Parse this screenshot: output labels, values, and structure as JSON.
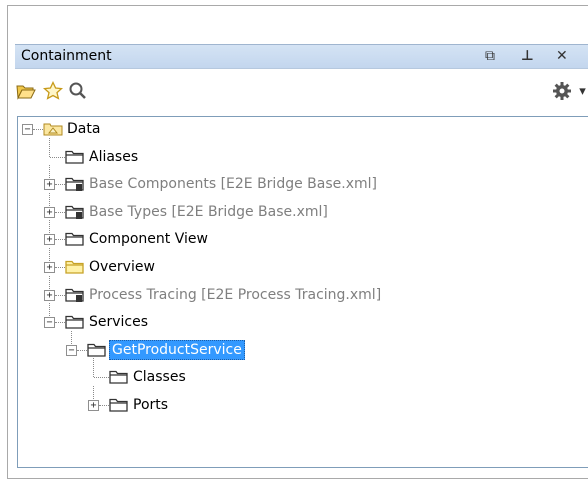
{
  "panel": {
    "title": "Containment",
    "title_buttons": [
      {
        "name": "restore-icon",
        "glyph": "⧉"
      },
      {
        "name": "pin-icon",
        "glyph": "⊥"
      },
      {
        "name": "close-icon",
        "glyph": "✕"
      }
    ]
  },
  "toolbar": {
    "open_icon": "folder-open-icon",
    "favorite_icon": "star-icon",
    "search_icon": "search-icon",
    "options_icon": "gear-icon",
    "options_arrow": "▾"
  },
  "tree": {
    "items": [
      {
        "label": "Data",
        "level": 0,
        "expander": "−",
        "icon": "package-folder-icon",
        "style": "black"
      },
      {
        "label": "Aliases",
        "level": 1,
        "expander": "",
        "icon": "folder-icon",
        "style": "black"
      },
      {
        "label": "Base Components [E2E Bridge Base.xml]",
        "level": 1,
        "expander": "+",
        "icon": "shared-folder-icon",
        "style": "gray"
      },
      {
        "label": "Base Types [E2E Bridge Base.xml]",
        "level": 1,
        "expander": "+",
        "icon": "shared-folder-icon",
        "style": "gray"
      },
      {
        "label": "Component View",
        "level": 1,
        "expander": "+",
        "icon": "folder-icon",
        "style": "black"
      },
      {
        "label": "Overview",
        "level": 1,
        "expander": "+",
        "icon": "yellow-folder-icon",
        "style": "black"
      },
      {
        "label": "Process Tracing [E2E Process Tracing.xml]",
        "level": 1,
        "expander": "+",
        "icon": "shared-folder-icon",
        "style": "gray"
      },
      {
        "label": "Services",
        "level": 1,
        "expander": "−",
        "icon": "folder-icon",
        "style": "black"
      },
      {
        "label": "GetProductService",
        "level": 2,
        "expander": "−",
        "icon": "folder-icon",
        "style": "selected"
      },
      {
        "label": "Classes",
        "level": 3,
        "expander": "",
        "icon": "folder-icon",
        "style": "black"
      },
      {
        "label": "Ports",
        "level": 3,
        "expander": "+",
        "icon": "folder-icon",
        "style": "black"
      }
    ]
  },
  "colors": {
    "selection": "#3399ff",
    "titlebar": "#c9dcf2",
    "muted_text": "#7f7f7f"
  }
}
